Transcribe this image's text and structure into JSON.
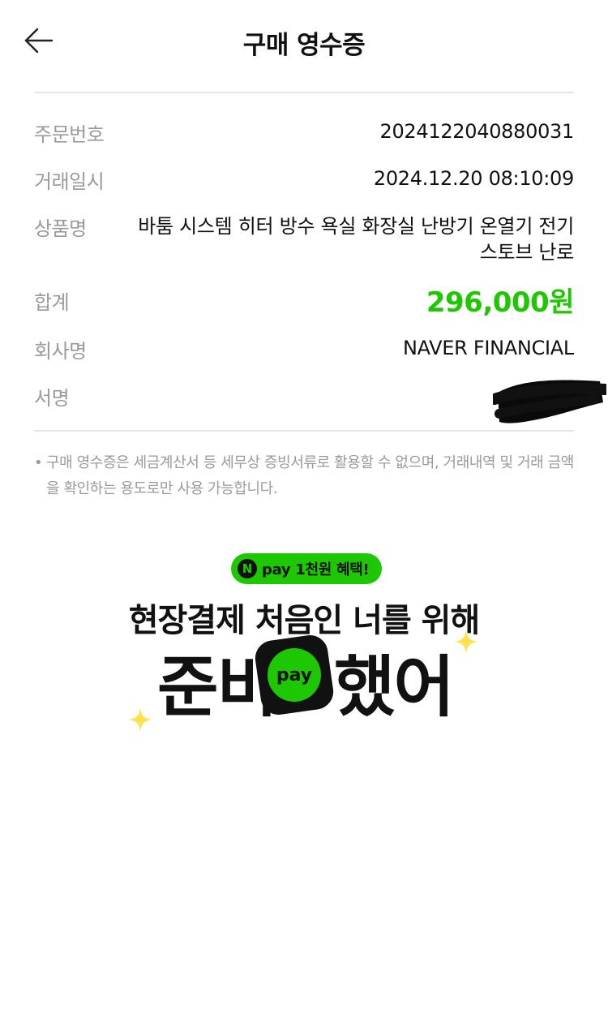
{
  "header": {
    "title": "구매 영수증"
  },
  "receipt": {
    "order_number": {
      "label": "주문번호",
      "value": "2024122040880031"
    },
    "transaction_datetime": {
      "label": "거래일시",
      "value": "2024.12.20 08:10:09"
    },
    "product_name": {
      "label": "상품명",
      "value": "바툼 시스템 히터 방수 욕실 화장실 난방기 온열기 전기 스토브 난로"
    },
    "total": {
      "label": "합계",
      "value": "296,000원"
    },
    "company": {
      "label": "회사명",
      "value": "NAVER FINANCIAL"
    },
    "signature": {
      "label": "서명"
    }
  },
  "notice": {
    "bullet": "•",
    "text": "구매 영수증은 세금계산서 등 세무상 증빙서류로 활용할 수 없으며, 거래내역 및 거래 금액을 확인하는 용도로만 사용 가능합니다."
  },
  "promo": {
    "badge_logo": "N",
    "badge_text": "pay 1천원 혜택!",
    "headline": "현장결제 처음인 너를 위해",
    "big_part1": "준비",
    "pay_icon_text": "pay",
    "big_part2": "했어"
  },
  "colors": {
    "accent_green": "#1ec800",
    "label_gray": "#9a9a9a",
    "sparkle_yellow": "#ffe14d"
  }
}
